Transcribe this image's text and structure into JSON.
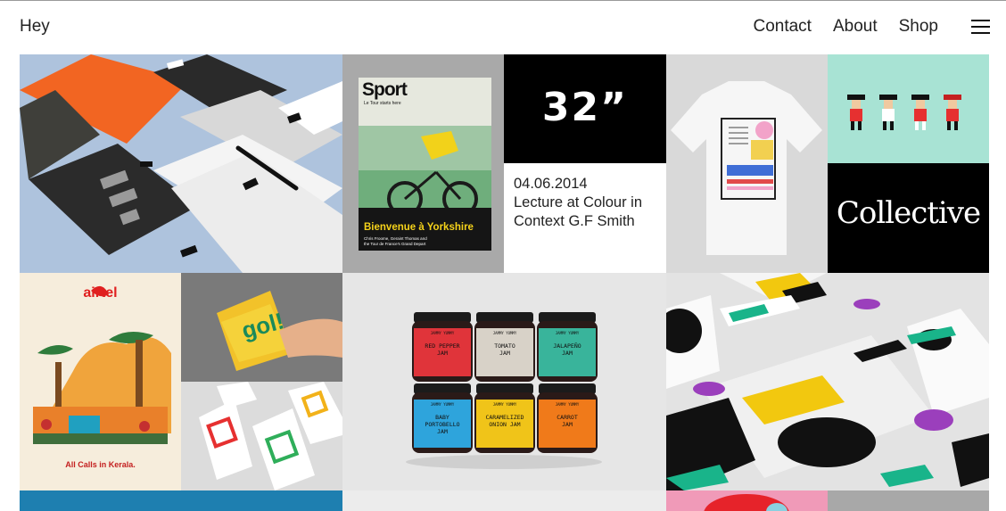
{
  "header": {
    "brand": "Hey",
    "nav": [
      {
        "label": "Contact"
      },
      {
        "label": "About"
      },
      {
        "label": "Shop"
      }
    ]
  },
  "tiles": {
    "magazine": {
      "title": "Sport",
      "subtitle": "Le Tour starts here",
      "headline": "Bienvenue à Yorkshire",
      "blurb_1": "Chris Froome, Geraint Thomas and",
      "blurb_2": "the Tour de France's Grand Depart"
    },
    "numeral": {
      "text": "32”"
    },
    "event": {
      "date": "04.06.2014",
      "line1": "Lecture at Colour in",
      "line2": "Context G.F Smith"
    },
    "collective": {
      "word": "Collective"
    },
    "airtel": {
      "brand": "airtel",
      "tagline": "All Calls in Kerala."
    },
    "goli": {
      "text": "gol!"
    },
    "jars": {
      "brand": "JAMMY YUMMY",
      "items": [
        {
          "line1": "RED PEPPER",
          "line2": "JAM",
          "color": "#e0343a"
        },
        {
          "line1": "TOMATO",
          "line2": "JAM",
          "color": "#d8d2c8"
        },
        {
          "line1": "JALAPEÑO",
          "line2": "JAM",
          "color": "#39b49b"
        },
        {
          "line1": "BABY",
          "line2": "PORTOBELLO",
          "line3": "JAM",
          "color": "#2ea4dc"
        },
        {
          "line1": "CARAMELIZED",
          "line2": "ONION JAM",
          "color": "#f0c419"
        },
        {
          "line1": "CARROT",
          "line2": "JAM",
          "color": "#f07a1a"
        }
      ]
    }
  }
}
